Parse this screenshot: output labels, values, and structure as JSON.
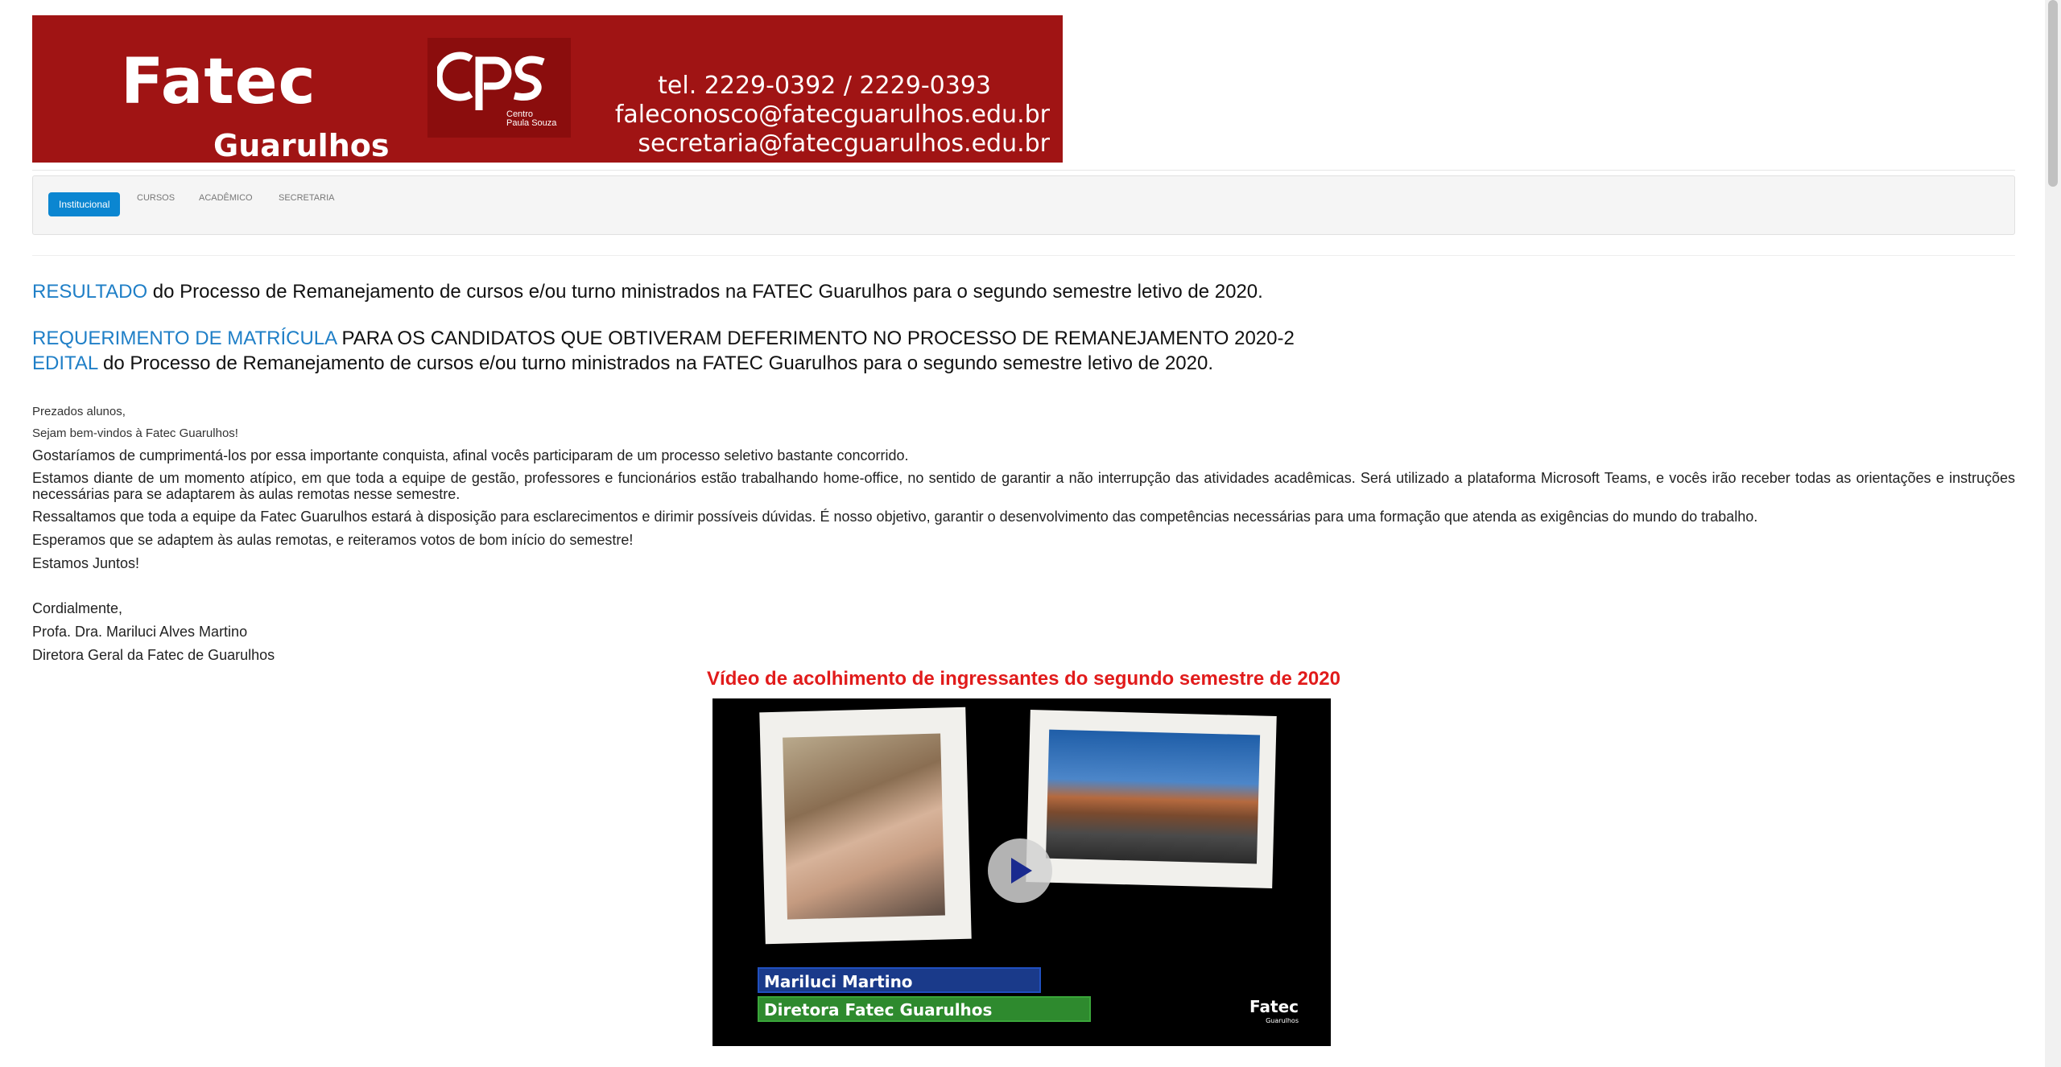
{
  "banner": {
    "title": "Fatec",
    "subtitle": "Guarulhos",
    "logo_text": "CPS",
    "logo_sub1": "Centro",
    "logo_sub2": "Paula Souza",
    "phone": "tel. 2229-0392 / 2229-0393",
    "email1": "faleconosco@fatecguarulhos.edu.br",
    "email2": "secretaria@fatecguarulhos.edu.br",
    "color": "#a01414"
  },
  "nav": {
    "items": [
      {
        "label": "Institucional"
      },
      {
        "label": "Cursos"
      },
      {
        "label": "Acadêmico"
      },
      {
        "label": "Secretaria"
      }
    ],
    "accent": "#0b86d1"
  },
  "links": {
    "resultado_link": "RESULTADO",
    "resultado_text": " do Processo de Remanejamento de cursos e/ou turno ministrados na FATEC Guarulhos para o segundo semestre letivo de 2020.",
    "requerimento_link": "REQUERIMENTO DE MATRÍCULA",
    "requerimento_text": " PARA OS CANDIDATOS QUE OBTIVERAM DEFERIMENTO NO PROCESSO DE REMANEJAMENTO 2020-2",
    "edital_link": "EDITAL",
    "edital_text": " do Processo de Remanejamento de cursos e/ou turno ministrados na FATEC Guarulhos para o segundo semestre letivo de 2020."
  },
  "letter": {
    "greeting": "Prezados alunos,",
    "welcome": "Sejam bem-vindos à Fatec Guarulhos!",
    "p1": "Gostaríamos de cumprimentá-los por essa importante conquista, afinal vocês participaram de um processo seletivo bastante concorrido.",
    "p2": "Estamos diante de um momento atípico, em que toda a equipe de gestão, professores e funcionários estão trabalhando home-office, no sentido de garantir a não interrupção das atividades acadêmicas. Será utilizado a plataforma Microsoft Teams, e vocês irão receber todas as orientações e instruções necessárias para se adaptarem às aulas remotas nesse semestre.",
    "p3": "Ressaltamos que toda a equipe da Fatec Guarulhos estará à disposição para esclarecimentos e dirimir possíveis dúvidas. É nosso objetivo, garantir o desenvolvimento das competências necessárias para uma formação que atenda as exigências do mundo do trabalho.",
    "p4": "Esperamos que se adaptem às aulas remotas, e reiteramos votos de bom início do semestre!",
    "p5": "Estamos Juntos!",
    "closing": "Cordialmente,",
    "signer": "Profa. Dra. Mariluci Alves Martino",
    "signer_role": "Diretora Geral da Fatec de Guarulhos"
  },
  "video": {
    "title": "Vídeo de acolhimento de ingressantes do segundo semestre de 2020",
    "title_color": "#e11b1b",
    "name_caption": "Mariluci Martino",
    "role_caption": "Diretora Fatec Guarulhos",
    "logo": "Fatec",
    "logo_sub": "Guarulhos",
    "play_icon": "play-icon"
  }
}
